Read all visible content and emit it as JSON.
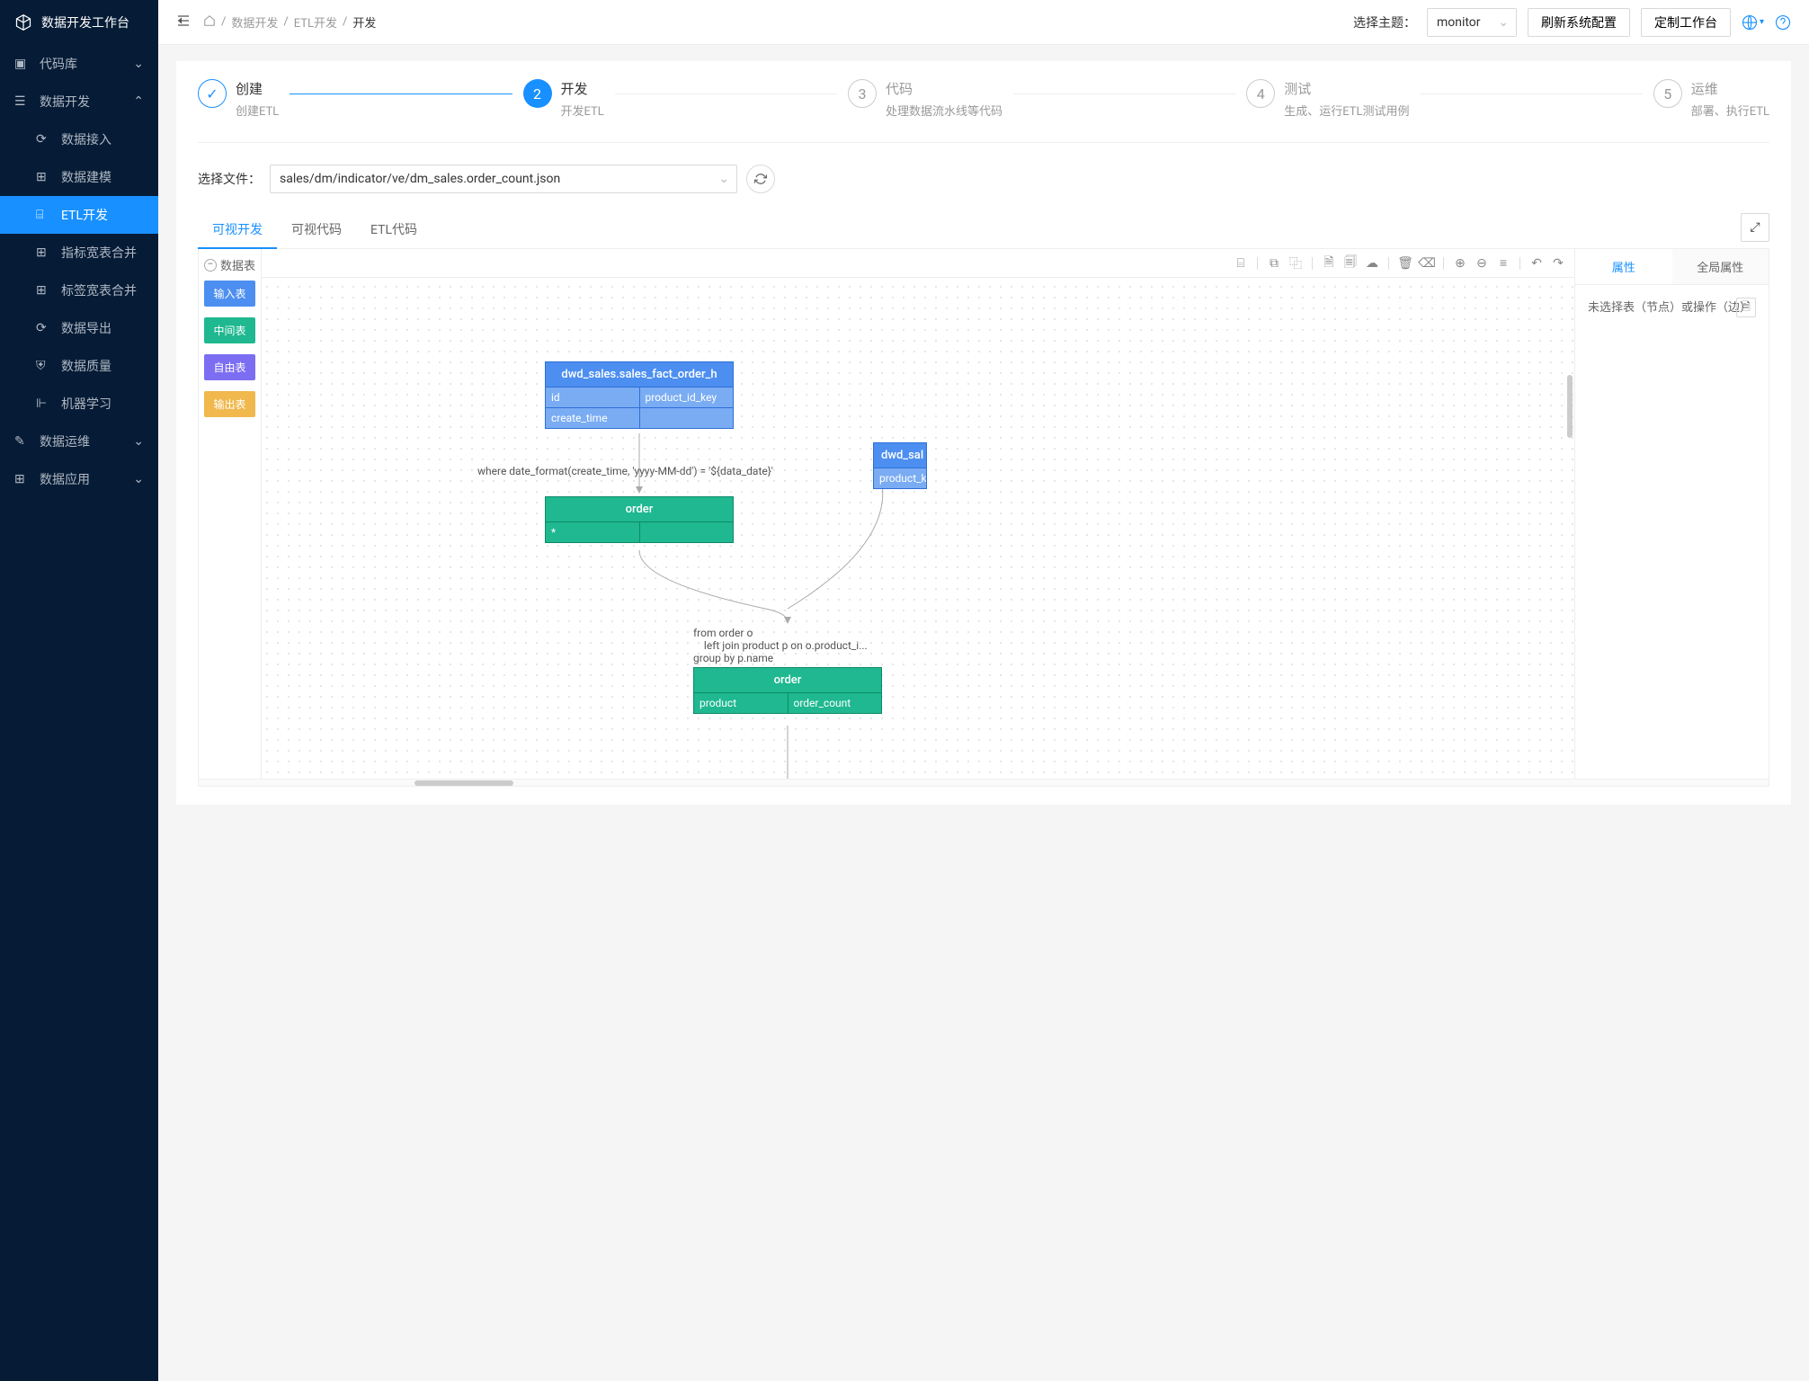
{
  "sidebar": {
    "logo_title": "数据开发工作台",
    "items": [
      {
        "label": "代码库",
        "expandable": true
      },
      {
        "label": "数据开发",
        "expandable": true,
        "open": true,
        "children": [
          {
            "label": "数据接入"
          },
          {
            "label": "数据建模"
          },
          {
            "label": "ETL开发",
            "active": true
          },
          {
            "label": "指标宽表合并"
          },
          {
            "label": "标签宽表合并"
          },
          {
            "label": "数据导出"
          },
          {
            "label": "数据质量"
          },
          {
            "label": "机器学习"
          }
        ]
      },
      {
        "label": "数据运维",
        "expandable": true
      },
      {
        "label": "数据应用",
        "expandable": true
      }
    ]
  },
  "header": {
    "breadcrumb": [
      "数据开发",
      "ETL开发",
      "开发"
    ],
    "theme_label": "选择主题：",
    "theme_value": "monitor",
    "btn_refresh": "刷新系统配置",
    "btn_custom": "定制工作台"
  },
  "steps": [
    {
      "num": "✓",
      "title": "创建",
      "desc": "创建ETL",
      "state": "done"
    },
    {
      "num": "2",
      "title": "开发",
      "desc": "开发ETL",
      "state": "active"
    },
    {
      "num": "3",
      "title": "代码",
      "desc": "处理数据流水线等代码",
      "state": "wait"
    },
    {
      "num": "4",
      "title": "测试",
      "desc": "生成、运行ETL测试用例",
      "state": "wait"
    },
    {
      "num": "5",
      "title": "运维",
      "desc": "部署、执行ETL",
      "state": "wait"
    }
  ],
  "file": {
    "label": "选择文件：",
    "value": "sales/dm/indicator/ve/dm_sales.order_count.json"
  },
  "tabs": [
    "可视开发",
    "可视代码",
    "ETL代码"
  ],
  "active_tab": 0,
  "palette": {
    "header": "数据表",
    "items": [
      "输入表",
      "中间表",
      "自由表",
      "输出表"
    ]
  },
  "graph": {
    "node1": {
      "title": "dwd_sales.sales_fact_order_h",
      "c1": "id",
      "c2": "product_id_key",
      "c3": "create_time"
    },
    "anno1": "where date_format(create_time, 'yyyy-MM-dd') = '${data_date}'",
    "node2": {
      "title": "order",
      "c1": "*"
    },
    "node3": {
      "title": "dwd_sal",
      "c1": "product_k"
    },
    "anno2_l1": "from order o",
    "anno2_l2": "    left join product p on o.product_i...",
    "anno2_l3": "group by p.name",
    "node4": {
      "title": "order",
      "c1": "product",
      "c2": "order_count"
    }
  },
  "props": {
    "tabs": [
      "属性",
      "全局属性"
    ],
    "active": 0,
    "empty": "未选择表（节点）或操作（边）"
  }
}
